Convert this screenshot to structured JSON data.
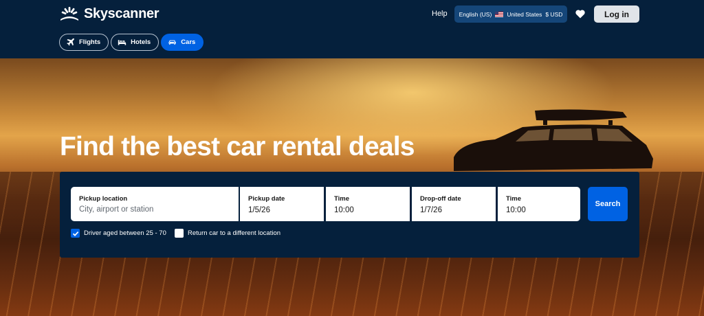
{
  "brand": {
    "name": "Skyscanner"
  },
  "header": {
    "help_label": "Help",
    "locale": {
      "language": "English (US)",
      "country": "United States",
      "currency": "$ USD"
    },
    "login_label": "Log in"
  },
  "tabs": [
    {
      "label": "Flights",
      "icon": "plane-icon",
      "active": false
    },
    {
      "label": "Hotels",
      "icon": "bed-icon",
      "active": false
    },
    {
      "label": "Cars",
      "icon": "car-icon",
      "active": true
    }
  ],
  "hero": {
    "title": "Find the best car rental deals"
  },
  "search": {
    "pickup_location": {
      "label": "Pickup location",
      "placeholder": "City, airport or station",
      "value": ""
    },
    "pickup_date": {
      "label": "Pickup date",
      "value": "1/5/26"
    },
    "pickup_time": {
      "label": "Time",
      "value": "10:00"
    },
    "dropoff_date": {
      "label": "Drop-off date",
      "value": "1/7/26"
    },
    "dropoff_time": {
      "label": "Time",
      "value": "10:00"
    },
    "search_label": "Search"
  },
  "options": {
    "driver_age": {
      "label": "Driver aged between 25 - 70",
      "checked": true
    },
    "different_location": {
      "label": "Return car to a different location",
      "checked": false
    }
  },
  "colors": {
    "navy": "#05203c",
    "accent": "#0062e3",
    "locale_bg": "#154679"
  }
}
